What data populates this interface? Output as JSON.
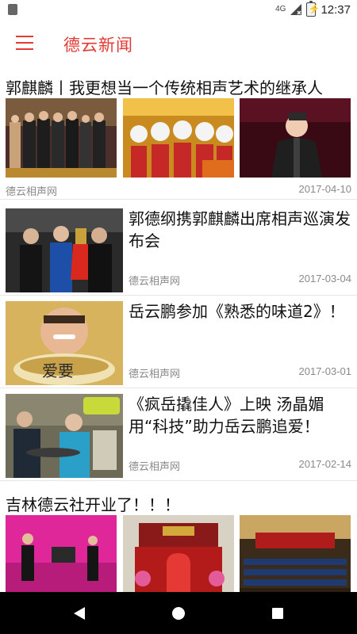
{
  "status_bar": {
    "network": "4G",
    "time": "12:37"
  },
  "app_bar": {
    "title": "德云新闻"
  },
  "news": [
    {
      "title": "郭麒麟丨我更想当一个传统相声艺术的继承人",
      "source": "德云相声网",
      "date": "2017-04-10"
    },
    {
      "title": "郭德纲携郭麒麟出席相声巡演发布会",
      "source": "德云相声网",
      "date": "2017-03-04"
    },
    {
      "title": "岳云鹏参加《熟悉的味道2》！",
      "source": "德云相声网",
      "date": "2017-03-01",
      "image_text": "爱要"
    },
    {
      "title": "《疯岳撬佳人》上映 汤晶媚用“科技”助力岳云鹏追爱！",
      "source": "德云相声网",
      "date": "2017-02-14"
    },
    {
      "title": "吉林德云社开业了！！！"
    }
  ],
  "colors": {
    "accent": "#e53935",
    "text_primary": "#111111",
    "text_secondary": "#8a8a8a"
  }
}
